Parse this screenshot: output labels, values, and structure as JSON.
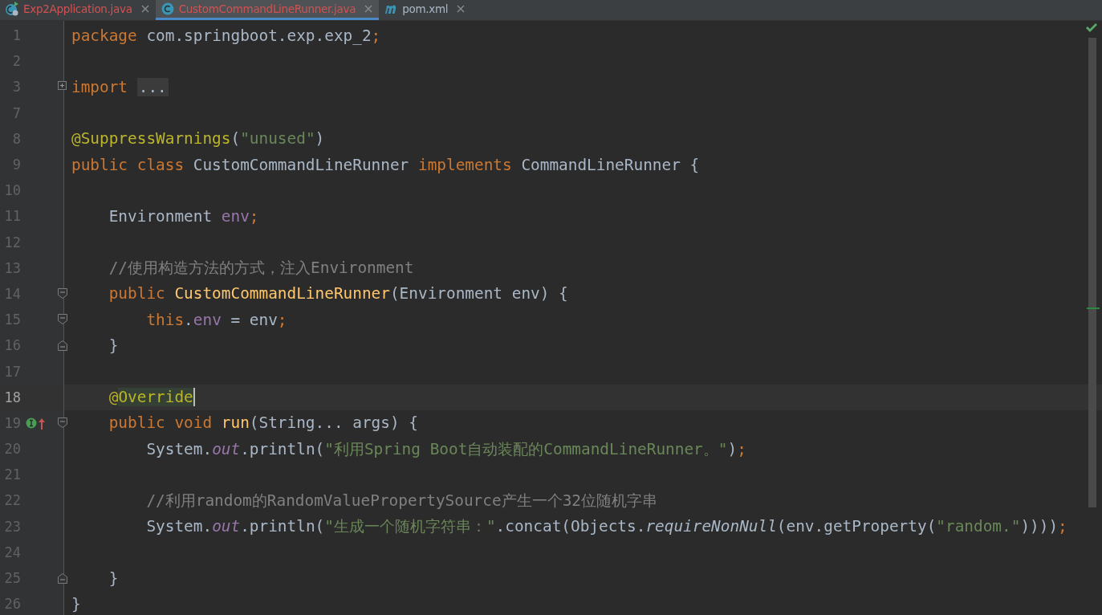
{
  "tabs": [
    {
      "kind": "runnable",
      "label": "Exp2Application.java",
      "color": "#d25252",
      "selected": false
    },
    {
      "kind": "class",
      "label": "CustomCommandLineRunner.java",
      "color": "#d25252",
      "selected": true
    },
    {
      "kind": "maven",
      "label": "pom.xml",
      "color": "#a9b7c6",
      "selected": false
    }
  ],
  "editor": {
    "inspection_ok": true,
    "lines": [
      {
        "number": "1",
        "current": false,
        "tokens": [
          {
            "kind": "kw",
            "text": "package "
          },
          {
            "kind": "plain",
            "text": "com.springboot.exp.exp_2"
          },
          {
            "kind": "kw",
            "text": ";"
          }
        ]
      },
      {
        "number": "2",
        "current": false
      },
      {
        "number": "3",
        "current": false,
        "kind": "collapsed",
        "tokens": [
          {
            "kind": "kw",
            "text": "import "
          },
          {
            "kind": "folded",
            "text": "..."
          }
        ]
      },
      {
        "number": "7",
        "current": false
      },
      {
        "number": "8",
        "current": false,
        "tokens": [
          {
            "kind": "anno",
            "text": "@SuppressWarnings"
          },
          {
            "kind": "plain",
            "text": "("
          },
          {
            "kind": "str",
            "text": "\"unused\""
          },
          {
            "kind": "plain",
            "text": ")"
          }
        ]
      },
      {
        "number": "9",
        "current": false,
        "tokens": [
          {
            "kind": "kw",
            "text": "public class "
          },
          {
            "kind": "plain",
            "text": "CustomCommandLineRunner "
          },
          {
            "kind": "kw",
            "text": "implements "
          },
          {
            "kind": "plain",
            "text": "CommandLineRunner {"
          }
        ]
      },
      {
        "number": "10",
        "current": false
      },
      {
        "number": "11",
        "current": false,
        "tokens": [
          {
            "kind": "plain",
            "text": "    Environment "
          },
          {
            "kind": "field",
            "text": "env"
          },
          {
            "kind": "kw",
            "text": ";"
          }
        ]
      },
      {
        "number": "12",
        "current": false
      },
      {
        "number": "13",
        "current": false,
        "tokens": [
          {
            "kind": "comment",
            "text": "    //使用构造方法的方式，注入Environment"
          }
        ]
      },
      {
        "number": "14",
        "current": false,
        "kind": "blockstart",
        "tokens": [
          {
            "kind": "kw",
            "text": "    public "
          },
          {
            "kind": "method",
            "text": "CustomCommandLineRunner"
          },
          {
            "kind": "plain",
            "text": "(Environment env) {"
          }
        ]
      },
      {
        "number": "15",
        "current": false,
        "kind": "blockstart",
        "tokens": [
          {
            "kind": "kw",
            "text": "        this"
          },
          {
            "kind": "plain",
            "text": "."
          },
          {
            "kind": "field",
            "text": "env"
          },
          {
            "kind": "plain",
            "text": " = env"
          },
          {
            "kind": "kw",
            "text": ";"
          }
        ]
      },
      {
        "number": "16",
        "current": false,
        "kind": "blockend",
        "tokens": [
          {
            "kind": "plain",
            "text": "    }"
          }
        ]
      },
      {
        "number": "17",
        "current": false
      },
      {
        "number": "18",
        "current": true,
        "tokens": [
          {
            "kind": "anno",
            "text": "    @"
          },
          {
            "kind": "anno-hl",
            "text": "Override"
          }
        ]
      },
      {
        "number": "19",
        "current": false,
        "kind": "override",
        "tokens": [
          {
            "kind": "kw",
            "text": "    public void "
          },
          {
            "kind": "method",
            "text": "run"
          },
          {
            "kind": "plain",
            "text": "(String... args) {"
          }
        ]
      },
      {
        "number": "20",
        "current": false,
        "tokens": [
          {
            "kind": "plain",
            "text": "        System."
          },
          {
            "kind": "static",
            "text": "out"
          },
          {
            "kind": "plain",
            "text": ".println("
          },
          {
            "kind": "str",
            "text": "\"利用Spring Boot自动装配的CommandLineRunner。\""
          },
          {
            "kind": "plain",
            "text": ")"
          },
          {
            "kind": "kw",
            "text": ";"
          }
        ]
      },
      {
        "number": "21",
        "current": false
      },
      {
        "number": "22",
        "current": false,
        "tokens": [
          {
            "kind": "comment",
            "text": "        //利用random的RandomValuePropertySource产生一个32位随机字串"
          }
        ]
      },
      {
        "number": "23",
        "current": false,
        "tokens": [
          {
            "kind": "plain",
            "text": "        System."
          },
          {
            "kind": "static",
            "text": "out"
          },
          {
            "kind": "plain",
            "text": ".println("
          },
          {
            "kind": "str",
            "text": "\"生成一个随机字符串：\""
          },
          {
            "kind": "plain",
            "text": ".concat(Objects."
          },
          {
            "kind": "italic",
            "text": "requireNonNull"
          },
          {
            "kind": "plain",
            "text": "(env.getProperty("
          },
          {
            "kind": "str",
            "text": "\"random.\""
          },
          {
            "kind": "plain",
            "text": "))))"
          },
          {
            "kind": "kw",
            "text": ";"
          }
        ]
      },
      {
        "number": "24",
        "current": false
      },
      {
        "number": "25",
        "current": false,
        "kind": "blockend",
        "tokens": [
          {
            "kind": "plain",
            "text": "    }"
          }
        ]
      },
      {
        "number": "26",
        "current": false,
        "tokens": [
          {
            "kind": "plain",
            "text": "}"
          }
        ]
      }
    ]
  }
}
